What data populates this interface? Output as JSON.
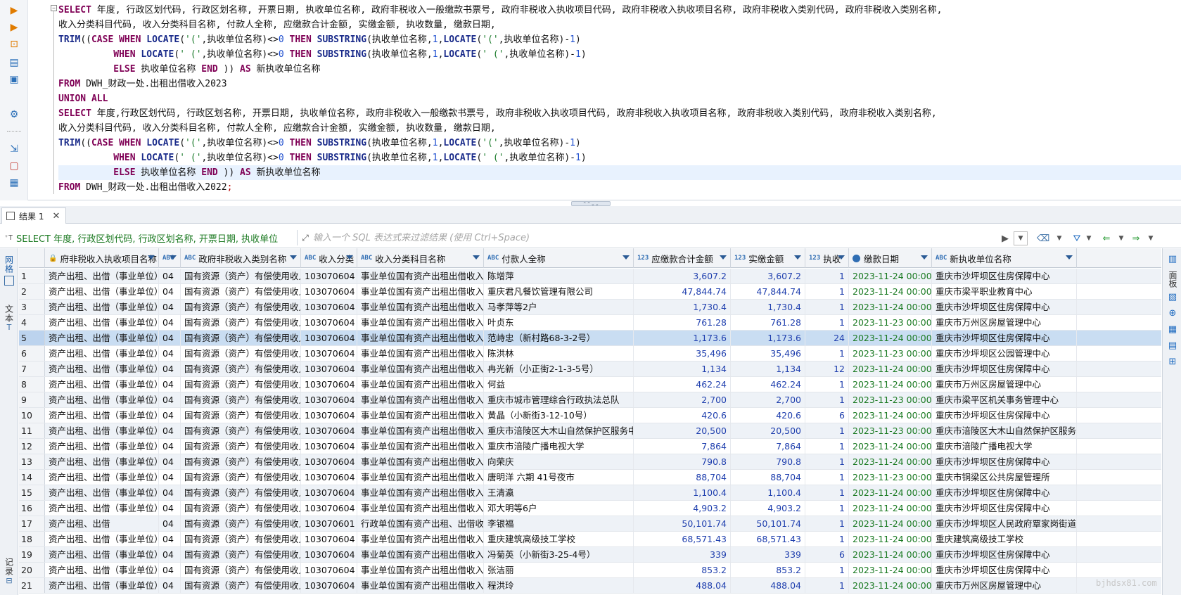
{
  "editor": {
    "lines": [
      [
        {
          "t": "SELECT",
          "c": "kw"
        },
        {
          "t": " 年度, 行政区划代码, 行政区划名称, 开票日期, 执收单位名称, 政府非税收入一般缴款书票号, 政府非税收入执收项目代码, 政府非税收入执收项目名称, 政府非税收入类别代码, 政府非税收入类别名称,",
          "c": "ident"
        }
      ],
      [
        {
          "t": "收入分类科目代码, 收入分类科目名称, 付款人全称, 应缴款合计金额, 实缴金额, 执收数量, 缴款日期,",
          "c": "ident"
        }
      ],
      [
        {
          "t": "TRIM",
          "c": "fn"
        },
        {
          "t": "((",
          "c": "punc"
        },
        {
          "t": "CASE WHEN",
          "c": "kw"
        },
        {
          "t": " ",
          "c": "punc"
        },
        {
          "t": "LOCATE",
          "c": "fn"
        },
        {
          "t": "(",
          "c": "punc"
        },
        {
          "t": "'('",
          "c": "str"
        },
        {
          "t": ",执收单位名称)<>",
          "c": "ident"
        },
        {
          "t": "0",
          "c": "num"
        },
        {
          "t": " ",
          "c": "punc"
        },
        {
          "t": "THEN",
          "c": "kw"
        },
        {
          "t": " ",
          "c": "punc"
        },
        {
          "t": "SUBSTRING",
          "c": "fn"
        },
        {
          "t": "(执收单位名称,",
          "c": "ident"
        },
        {
          "t": "1",
          "c": "num"
        },
        {
          "t": ",",
          "c": "punc"
        },
        {
          "t": "LOCATE",
          "c": "fn"
        },
        {
          "t": "(",
          "c": "punc"
        },
        {
          "t": "'('",
          "c": "str"
        },
        {
          "t": ",执收单位名称)-",
          "c": "ident"
        },
        {
          "t": "1",
          "c": "num"
        },
        {
          "t": ")",
          "c": "punc"
        }
      ],
      [
        {
          "t": "          ",
          "c": "punc"
        },
        {
          "t": "WHEN",
          "c": "kw"
        },
        {
          "t": " ",
          "c": "punc"
        },
        {
          "t": "LOCATE",
          "c": "fn"
        },
        {
          "t": "(",
          "c": "punc"
        },
        {
          "t": "' ('",
          "c": "str"
        },
        {
          "t": ",执收单位名称)<>",
          "c": "ident"
        },
        {
          "t": "0",
          "c": "num"
        },
        {
          "t": " ",
          "c": "punc"
        },
        {
          "t": "THEN",
          "c": "kw"
        },
        {
          "t": " ",
          "c": "punc"
        },
        {
          "t": "SUBSTRING",
          "c": "fn"
        },
        {
          "t": "(执收单位名称,",
          "c": "ident"
        },
        {
          "t": "1",
          "c": "num"
        },
        {
          "t": ",",
          "c": "punc"
        },
        {
          "t": "LOCATE",
          "c": "fn"
        },
        {
          "t": "(",
          "c": "punc"
        },
        {
          "t": "' ('",
          "c": "str"
        },
        {
          "t": ",执收单位名称)-",
          "c": "ident"
        },
        {
          "t": "1",
          "c": "num"
        },
        {
          "t": ")",
          "c": "punc"
        }
      ],
      [
        {
          "t": "          ",
          "c": "punc"
        },
        {
          "t": "ELSE",
          "c": "kw"
        },
        {
          "t": " 执收单位名称 ",
          "c": "ident"
        },
        {
          "t": "END",
          "c": "kw"
        },
        {
          "t": " )) ",
          "c": "punc"
        },
        {
          "t": "AS",
          "c": "kw"
        },
        {
          "t": " 新执收单位名称",
          "c": "ident"
        }
      ],
      [
        {
          "t": "FROM",
          "c": "kw"
        },
        {
          "t": " DWH_财政一处.出租出借收入2023",
          "c": "ident"
        }
      ],
      [
        {
          "t": "UNION ALL",
          "c": "kw"
        }
      ],
      [
        {
          "t": "SELECT",
          "c": "kw"
        },
        {
          "t": " 年度,行政区划代码, 行政区划名称, 开票日期, 执收单位名称, 政府非税收入一般缴款书票号, 政府非税收入执收项目代码, 政府非税收入执收项目名称, 政府非税收入类别代码, 政府非税收入类别名称,",
          "c": "ident"
        }
      ],
      [
        {
          "t": "收入分类科目代码, 收入分类科目名称, 付款人全称, 应缴款合计金额, 实缴金额, 执收数量, 缴款日期,",
          "c": "ident"
        }
      ],
      [
        {
          "t": "TRIM",
          "c": "fn"
        },
        {
          "t": "((",
          "c": "punc"
        },
        {
          "t": "CASE WHEN",
          "c": "kw"
        },
        {
          "t": " ",
          "c": "punc"
        },
        {
          "t": "LOCATE",
          "c": "fn"
        },
        {
          "t": "(",
          "c": "punc"
        },
        {
          "t": "'('",
          "c": "str"
        },
        {
          "t": ",执收单位名称)<>",
          "c": "ident"
        },
        {
          "t": "0",
          "c": "num"
        },
        {
          "t": " ",
          "c": "punc"
        },
        {
          "t": "THEN",
          "c": "kw"
        },
        {
          "t": " ",
          "c": "punc"
        },
        {
          "t": "SUBSTRING",
          "c": "fn"
        },
        {
          "t": "(执收单位名称,",
          "c": "ident"
        },
        {
          "t": "1",
          "c": "num"
        },
        {
          "t": ",",
          "c": "punc"
        },
        {
          "t": "LOCATE",
          "c": "fn"
        },
        {
          "t": "(",
          "c": "punc"
        },
        {
          "t": "'('",
          "c": "str"
        },
        {
          "t": ",执收单位名称)-",
          "c": "ident"
        },
        {
          "t": "1",
          "c": "num"
        },
        {
          "t": ")",
          "c": "punc"
        }
      ],
      [
        {
          "t": "          ",
          "c": "punc"
        },
        {
          "t": "WHEN",
          "c": "kw"
        },
        {
          "t": " ",
          "c": "punc"
        },
        {
          "t": "LOCATE",
          "c": "fn"
        },
        {
          "t": "(",
          "c": "punc"
        },
        {
          "t": "' ('",
          "c": "str"
        },
        {
          "t": ",执收单位名称)<>",
          "c": "ident"
        },
        {
          "t": "0",
          "c": "num"
        },
        {
          "t": " ",
          "c": "punc"
        },
        {
          "t": "THEN",
          "c": "kw"
        },
        {
          "t": " ",
          "c": "punc"
        },
        {
          "t": "SUBSTRING",
          "c": "fn"
        },
        {
          "t": "(执收单位名称,",
          "c": "ident"
        },
        {
          "t": "1",
          "c": "num"
        },
        {
          "t": ",",
          "c": "punc"
        },
        {
          "t": "LOCATE",
          "c": "fn"
        },
        {
          "t": "(",
          "c": "punc"
        },
        {
          "t": "' ('",
          "c": "str"
        },
        {
          "t": ",执收单位名称)-",
          "c": "ident"
        },
        {
          "t": "1",
          "c": "num"
        },
        {
          "t": ")",
          "c": "punc"
        }
      ],
      [
        {
          "t": "          ",
          "c": "punc"
        },
        {
          "t": "ELSE",
          "c": "kw"
        },
        {
          "t": " 执收单位名称 ",
          "c": "ident"
        },
        {
          "t": "END",
          "c": "kw"
        },
        {
          "t": " )) ",
          "c": "punc"
        },
        {
          "t": "AS",
          "c": "kw"
        },
        {
          "t": " 新执收单位名称",
          "c": "ident"
        }
      ],
      [
        {
          "t": "FROM",
          "c": "kw"
        },
        {
          "t": " DWH_财政一处.出租出借收入2022",
          "c": "ident"
        },
        {
          "t": ";",
          "c": "semi"
        }
      ]
    ],
    "current_line": 11,
    "toolbar_icons": [
      "execute-statement-icon",
      "execute-script-icon",
      "explain-plan-icon",
      "load-script-icon",
      "export-script-icon",
      "settings-icon",
      "more-icon",
      "open-file-icon",
      "save-file-icon",
      "format-icon"
    ]
  },
  "results": {
    "tab_label": "结果 1",
    "sql_summary": "SELECT 年度, 行政区划代码, 行政区划名称, 开票日期, 执收单位",
    "filter_placeholder": "输入一个 SQL 表达式来过滤结果 (使用 Ctrl+Space)",
    "left_tabs": [
      "网格",
      "文本",
      "记录"
    ],
    "right_tab": "面板",
    "columns": [
      {
        "label": "",
        "type": ""
      },
      {
        "label": "府非税收入执收项目名称",
        "type": "lock"
      },
      {
        "label": "",
        "type": "ABC"
      },
      {
        "label": "政府非税收入类别名称",
        "type": "ABC"
      },
      {
        "label": "收入分类",
        "type": "ABC"
      },
      {
        "label": "收入分类科目名称",
        "type": "ABC"
      },
      {
        "label": "付款人全称",
        "type": "ABC"
      },
      {
        "label": "应缴款合计金额",
        "type": "123"
      },
      {
        "label": "实缴金额",
        "type": "123"
      },
      {
        "label": "执收",
        "type": "123"
      },
      {
        "label": "缴款日期",
        "type": "clock"
      },
      {
        "label": "新执收单位名称",
        "type": "ABC"
      }
    ],
    "rows": [
      [
        "1",
        "资产出租、出借（事业单位）",
        "04",
        "国有资源（资产）有偿使用收入",
        "103070604",
        "事业单位国有资产出租出借收入",
        "陈增萍",
        "3,607.2",
        "3,607.2",
        "1",
        "2023-11-24 00:00:00",
        "重庆市沙坪坝区住房保障中心"
      ],
      [
        "2",
        "资产出租、出借（事业单位）",
        "04",
        "国有资源（资产）有偿使用收入",
        "103070604",
        "事业单位国有资产出租出借收入",
        "重庆君凡餐饮管理有限公司",
        "47,844.74",
        "47,844.74",
        "1",
        "2023-11-24 00:00:00",
        "重庆市梁平职业教育中心"
      ],
      [
        "3",
        "资产出租、出借（事业单位）",
        "04",
        "国有资源（资产）有偿使用收入",
        "103070604",
        "事业单位国有资产出租出借收入",
        "马孝萍等2户",
        "1,730.4",
        "1,730.4",
        "1",
        "2023-11-24 00:00:00",
        "重庆市沙坪坝区住房保障中心"
      ],
      [
        "4",
        "资产出租、出借（事业单位）",
        "04",
        "国有资源（资产）有偿使用收入",
        "103070604",
        "事业单位国有资产出租出借收入",
        "叶贞东",
        "761.28",
        "761.28",
        "1",
        "2023-11-23 00:00:00",
        "重庆市万州区房屋管理中心"
      ],
      [
        "5",
        "资产出租、出借（事业单位）",
        "04",
        "国有资源（资产）有偿使用收入",
        "103070604",
        "事业单位国有资产出租出借收入",
        "范峙忠（新村路68-3-2号）",
        "1,173.6",
        "1,173.6",
        "24",
        "2023-11-24 00:00:00",
        "重庆市沙坪坝区住房保障中心"
      ],
      [
        "6",
        "资产出租、出借（事业单位）",
        "04",
        "国有资源（资产）有偿使用收入",
        "103070604",
        "事业单位国有资产出租出借收入",
        "陈洪林",
        "35,496",
        "35,496",
        "1",
        "2023-11-23 00:00:00",
        "重庆市沙坪坝区公园管理中心"
      ],
      [
        "7",
        "资产出租、出借（事业单位）",
        "04",
        "国有资源（资产）有偿使用收入",
        "103070604",
        "事业单位国有资产出租出借收入",
        "冉光新（小正街2-1-3-5号）",
        "1,134",
        "1,134",
        "12",
        "2023-11-24 00:00:00",
        "重庆市沙坪坝区住房保障中心"
      ],
      [
        "8",
        "资产出租、出借（事业单位）",
        "04",
        "国有资源（资产）有偿使用收入",
        "103070604",
        "事业单位国有资产出租出借收入",
        "何益",
        "462.24",
        "462.24",
        "1",
        "2023-11-24 00:00:00",
        "重庆市万州区房屋管理中心"
      ],
      [
        "9",
        "资产出租、出借（事业单位）",
        "04",
        "国有资源（资产）有偿使用收入",
        "103070604",
        "事业单位国有资产出租出借收入",
        "重庆市城市管理综合行政执法总队",
        "2,700",
        "2,700",
        "1",
        "2023-11-23 00:00:00",
        "重庆市梁平区机关事务管理中心"
      ],
      [
        "10",
        "资产出租、出借（事业单位）",
        "04",
        "国有资源（资产）有偿使用收入",
        "103070604",
        "事业单位国有资产出租出借收入",
        "黄晶（小新街3-12-10号）",
        "420.6",
        "420.6",
        "6",
        "2023-11-24 00:00:00",
        "重庆市沙坪坝区住房保障中心"
      ],
      [
        "11",
        "资产出租、出借（事业单位）",
        "04",
        "国有资源（资产）有偿使用收入",
        "103070604",
        "事业单位国有资产出租出借收入",
        "重庆市涪陵区大木山自然保护区服务中心",
        "20,500",
        "20,500",
        "1",
        "2023-11-23 00:00:00",
        "重庆市涪陵区大木山自然保护区服务中心"
      ],
      [
        "12",
        "资产出租、出借（事业单位）",
        "04",
        "国有资源（资产）有偿使用收入",
        "103070604",
        "事业单位国有资产出租出借收入",
        "重庆市涪陵广播电视大学",
        "7,864",
        "7,864",
        "1",
        "2023-11-24 00:00:00",
        "重庆市涪陵广播电视大学"
      ],
      [
        "13",
        "资产出租、出借（事业单位）",
        "04",
        "国有资源（资产）有偿使用收入",
        "103070604",
        "事业单位国有资产出租出借收入",
        "向荣庆",
        "790.8",
        "790.8",
        "1",
        "2023-11-24 00:00:00",
        "重庆市沙坪坝区住房保障中心"
      ],
      [
        "14",
        "资产出租、出借（事业单位）",
        "04",
        "国有资源（资产）有偿使用收入",
        "103070604",
        "事业单位国有资产出租出借收入",
        "唐明洋 六期 41号夜市",
        "88,704",
        "88,704",
        "1",
        "2023-11-23 00:00:00",
        "重庆市铜梁区公共房屋管理所"
      ],
      [
        "15",
        "资产出租、出借（事业单位）",
        "04",
        "国有资源（资产）有偿使用收入",
        "103070604",
        "事业单位国有资产出租出借收入",
        "王清瀛",
        "1,100.4",
        "1,100.4",
        "1",
        "2023-11-24 00:00:00",
        "重庆市沙坪坝区住房保障中心"
      ],
      [
        "16",
        "资产出租、出借（事业单位）",
        "04",
        "国有资源（资产）有偿使用收入",
        "103070604",
        "事业单位国有资产出租出借收入",
        "邓大明等6户",
        "4,903.2",
        "4,903.2",
        "1",
        "2023-11-24 00:00:00",
        "重庆市沙坪坝区住房保障中心"
      ],
      [
        "17",
        "资产出租、出借",
        "04",
        "国有资源（资产）有偿使用收入",
        "103070601",
        "行政单位国有资产出租、出借收入",
        "李银福",
        "50,101.74",
        "50,101.74",
        "1",
        "2023-11-24 00:00:00",
        "重庆市沙坪坝区人民政府覃家岗街道办事处"
      ],
      [
        "18",
        "资产出租、出借（事业单位）",
        "04",
        "国有资源（资产）有偿使用收入",
        "103070604",
        "事业单位国有资产出租出借收入",
        "重庆建筑高级技工学校",
        "68,571.43",
        "68,571.43",
        "1",
        "2023-11-24 00:00:00",
        "重庆建筑高级技工学校"
      ],
      [
        "19",
        "资产出租、出借（事业单位）",
        "04",
        "国有资源（资产）有偿使用收入",
        "103070604",
        "事业单位国有资产出租出借收入",
        "冯菊英（小新街3-25-4号）",
        "339",
        "339",
        "6",
        "2023-11-24 00:00:00",
        "重庆市沙坪坝区住房保障中心"
      ],
      [
        "20",
        "资产出租、出借（事业单位）",
        "04",
        "国有资源（资产）有偿使用收入",
        "103070604",
        "事业单位国有资产出租出借收入",
        "张洁丽",
        "853.2",
        "853.2",
        "1",
        "2023-11-24 00:00:00",
        "重庆市沙坪坝区住房保障中心"
      ],
      [
        "21",
        "资产出租、出借（事业单位）",
        "04",
        "国有资源（资产）有偿使用收入",
        "103070604",
        "事业单位国有资产出租出借收入",
        "程洪玲",
        "488.04",
        "488.04",
        "1",
        "2023-11-24 00:00:00",
        "重庆市万州区房屋管理中心"
      ]
    ],
    "selected_row": 4,
    "watermark": "bjhdsx81.com"
  }
}
